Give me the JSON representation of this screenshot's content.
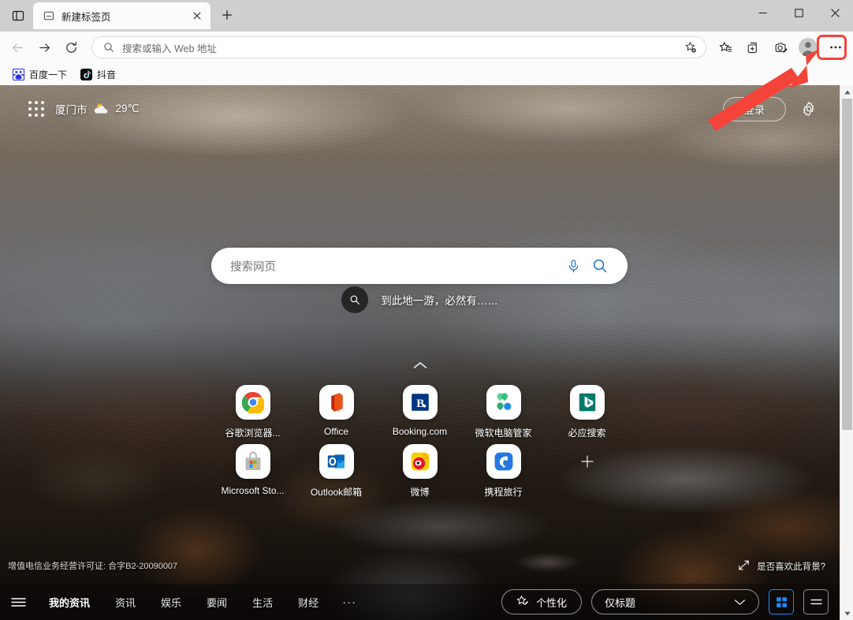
{
  "window": {
    "minimize_label": "−",
    "maximize_label": "□",
    "close_label": "✕"
  },
  "tabstrip": {
    "split_screen_icon": "split-screen-icon",
    "tabs": [
      {
        "title": "新建标签页",
        "favicon": "newtab-favicon",
        "close_label": "✕"
      }
    ],
    "new_tab_label": "+"
  },
  "toolbar": {
    "back_label": "←",
    "forward_label": "→",
    "refresh_label": "↻",
    "address_placeholder": "搜索或输入 Web 地址",
    "address_value": "",
    "add_favorite_icon": "add-favorite-star-icon",
    "favorites_icon": "favorites-icon",
    "collections_icon": "collections-icon",
    "copilot_icon": "copilot-screenshot-icon",
    "profile_icon": "profile-avatar-icon",
    "more_label": "···",
    "highlight_color": "#f4443a"
  },
  "bookmarks": [
    {
      "label": "百度一下",
      "icon": "baidu-icon"
    },
    {
      "label": "抖音",
      "icon": "douyin-icon"
    }
  ],
  "ntp": {
    "app_grid_icon": "app-grid-icon",
    "weather": {
      "city": "厦门市",
      "temperature": "29℃",
      "icon": "partly-cloudy-icon"
    },
    "signin_label": "登录",
    "settings_icon": "gear-icon",
    "search": {
      "placeholder": "搜索网页",
      "value": "",
      "mic_icon": "microphone-icon",
      "search_icon": "search-icon",
      "accent": "#1668c8"
    },
    "travel": {
      "icon": "search-circle-icon",
      "text": "到此地一游，必然有……"
    },
    "collapse_icon": "chevron-up-icon",
    "tiles": [
      [
        {
          "label": "谷歌浏览器...",
          "icon": "chrome-icon"
        },
        {
          "label": "Office",
          "icon": "office-icon"
        },
        {
          "label": "Booking.com",
          "icon": "booking-icon"
        },
        {
          "label": "微软电脑管家",
          "icon": "pc-manager-icon"
        },
        {
          "label": "必应搜索",
          "icon": "bing-icon"
        }
      ],
      [
        {
          "label": "Microsoft Sto...",
          "icon": "microsoft-store-icon"
        },
        {
          "label": "Outlook邮箱",
          "icon": "outlook-icon"
        },
        {
          "label": "微博",
          "icon": "weibo-icon"
        },
        {
          "label": "携程旅行",
          "icon": "ctrip-icon"
        }
      ]
    ],
    "add_tile_label": "+",
    "license": "增值电信业务经营许可证: 合字B2-20090007",
    "background_like": {
      "label": "是否喜欢此背景?",
      "icon": "expand-arrow-icon"
    }
  },
  "newsbar": {
    "menu_icon": "hamburger-icon",
    "tabs": [
      {
        "label": "我的资讯",
        "active": true
      },
      {
        "label": "资讯",
        "active": false
      },
      {
        "label": "娱乐",
        "active": false
      },
      {
        "label": "要闻",
        "active": false
      },
      {
        "label": "生活",
        "active": false
      },
      {
        "label": "财经",
        "active": false
      }
    ],
    "overflow_label": "···",
    "personalize_label": "个性化",
    "personalize_icon": "personalize-star-icon",
    "layout_select": {
      "value": "仅标题",
      "chevron_icon": "chevron-down-icon"
    },
    "grid_view_icon": "grid-view-icon",
    "list_view_icon": "list-view-icon",
    "active_view": "grid",
    "active_view_color": "#1a8cff"
  },
  "scrollbar": {
    "up_arrow": "▲",
    "down_arrow": "▼"
  }
}
